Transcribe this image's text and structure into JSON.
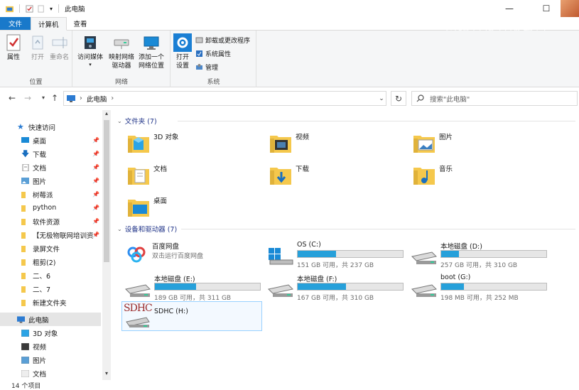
{
  "window": {
    "title": "此电脑",
    "controls": {
      "minimize": "—",
      "maximize": "☐"
    },
    "watermark": "网络科技有限公司"
  },
  "ribbon": {
    "tabs": [
      {
        "label": "文件"
      },
      {
        "label": "计算机"
      },
      {
        "label": "查看"
      }
    ],
    "groups": {
      "location": {
        "label": "位置",
        "properties": "属性",
        "open": "打开",
        "rename": "重命名"
      },
      "network": {
        "label": "网络",
        "media": "访问媒体",
        "map_drive_1": "映射网络",
        "map_drive_2": "驱动器",
        "add_location_1": "添加一个",
        "add_location_2": "网络位置"
      },
      "system": {
        "label": "系统",
        "open_settings_1": "打开",
        "open_settings_2": "设置",
        "uninstall": "卸载或更改程序",
        "sys_props": "系统属性",
        "manage": "管理"
      }
    }
  },
  "address": {
    "path": "此电脑",
    "search_placeholder": "搜索\"此电脑\""
  },
  "nav": {
    "quick_access": "快速访问",
    "items": [
      {
        "label": "桌面",
        "icon": "desktop-icon"
      },
      {
        "label": "下载",
        "icon": "download-icon"
      },
      {
        "label": "文档",
        "icon": "documents-icon"
      },
      {
        "label": "图片",
        "icon": "pictures-icon"
      },
      {
        "label": "树莓派",
        "icon": "folder-icon"
      },
      {
        "label": "python",
        "icon": "folder-icon"
      },
      {
        "label": "软件资源",
        "icon": "folder-icon"
      },
      {
        "label": "【无极物联网培训资",
        "icon": "folder-icon"
      },
      {
        "label": "录屏文件",
        "icon": "folder-icon"
      },
      {
        "label": "粗剪(2)",
        "icon": "folder-icon"
      },
      {
        "label": "二、6",
        "icon": "folder-icon"
      },
      {
        "label": "二、7",
        "icon": "folder-icon"
      },
      {
        "label": "新建文件夹",
        "icon": "folder-icon"
      }
    ],
    "this_pc": "此电脑",
    "pc_items": [
      {
        "label": "3D 对象"
      },
      {
        "label": "视频"
      },
      {
        "label": "图片"
      },
      {
        "label": "文档"
      }
    ]
  },
  "content": {
    "folders_header": "文件夹 (7)",
    "folders": [
      {
        "label": "3D 对象",
        "icon": "3d-objects-icon"
      },
      {
        "label": "视频",
        "icon": "videos-icon"
      },
      {
        "label": "图片",
        "icon": "pictures-folder-icon"
      },
      {
        "label": "文档",
        "icon": "documents-folder-icon"
      },
      {
        "label": "下载",
        "icon": "downloads-folder-icon"
      },
      {
        "label": "音乐",
        "icon": "music-folder-icon"
      },
      {
        "label": "桌面",
        "icon": "desktop-folder-icon"
      }
    ],
    "drives_header": "设备和驱动器 (7)",
    "baidu": {
      "name": "百度网盘",
      "sub": "双击运行百度网盘"
    },
    "drives": [
      {
        "name": "OS (C:)",
        "info": "151 GB 可用，共 237 GB",
        "used": 0.363
      },
      {
        "name": "本地磁盘 (D:)",
        "info": "257 GB 可用，共 310 GB",
        "used": 0.171
      },
      {
        "name": "本地磁盘 (E:)",
        "info": "189 GB 可用，共 311 GB",
        "used": 0.392
      },
      {
        "name": "本地磁盘 (F:)",
        "info": "167 GB 可用，共 310 GB",
        "used": 0.461
      },
      {
        "name": "boot (G:)",
        "info": "198 MB 可用，共 252 MB",
        "used": 0.214
      }
    ],
    "sdhc": {
      "name": "SDHC (H:)",
      "badge": "SDHC"
    }
  },
  "status": {
    "count": "14 个项目"
  },
  "colors": {
    "accent": "#1979ca",
    "bar": "#26a0da",
    "folder": "#f5c84c",
    "header": "#1e3287"
  }
}
